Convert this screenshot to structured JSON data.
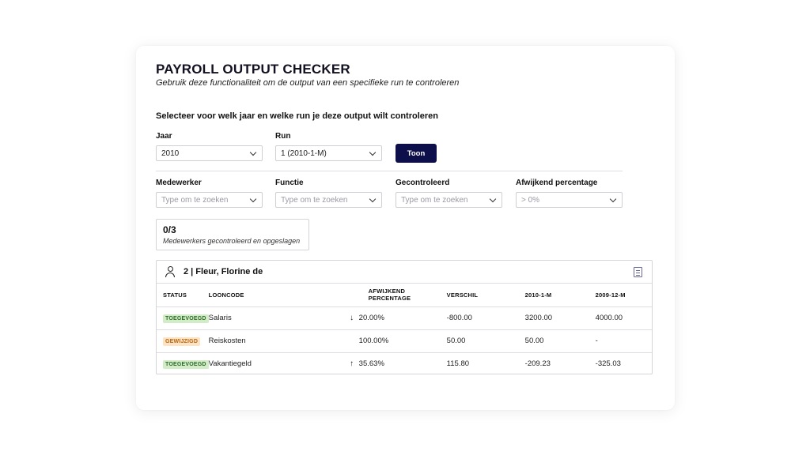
{
  "header": {
    "title": "PAYROLL OUTPUT CHECKER",
    "subtitle": "Gebruik deze functionaliteit om de output van een specifieke run te controleren"
  },
  "selection": {
    "heading": "Selecteer voor welk jaar en welke run je deze output wilt controleren",
    "year_label": "Jaar",
    "year_value": "2010",
    "run_label": "Run",
    "run_value": "1 (2010-1-M)",
    "show_button": "Toon"
  },
  "filters": {
    "employee_label": "Medewerker",
    "employee_placeholder": "Type om te zoeken",
    "function_label": "Functie",
    "function_placeholder": "Type om te zoeken",
    "checked_label": "Gecontroleerd",
    "checked_placeholder": "Type om te zoeken",
    "deviation_label": "Afwijkend percentage",
    "deviation_value": "> 0%"
  },
  "counter": {
    "value": "0/3",
    "description": "Medewerkers gecontroleerd en opgeslagen"
  },
  "employee": {
    "name": "2 | Fleur, Florine de",
    "icons": {
      "user": "user-icon",
      "document": "document-icon"
    }
  },
  "table": {
    "columns": [
      "STATUS",
      "LOONCODE",
      "AFWIJKEND PERCENTAGE",
      "VERSCHIL",
      "2010-1-M",
      "2009-12-M"
    ],
    "rows": [
      {
        "status": "TOEGEVOEGD",
        "status_bg": "#d3ecc8",
        "status_fg": "#2e6b2a",
        "code": "Salaris",
        "arrow": "↓",
        "percentage": "20.00%",
        "difference": "-800.00",
        "current": "3200.00",
        "previous": "4000.00"
      },
      {
        "status": "GEWIJZIGD",
        "status_bg": "#fbe3c4",
        "status_fg": "#b8640f",
        "code": "Reiskosten",
        "arrow": "",
        "percentage": "100.00%",
        "difference": "50.00",
        "current": "50.00",
        "previous": "-"
      },
      {
        "status": "TOEGEVOEGD",
        "status_bg": "#d3ecc8",
        "status_fg": "#2e6b2a",
        "code": "Vakantiegeld",
        "arrow": "↑",
        "percentage": "35.63%",
        "difference": "115.80",
        "current": "-209.23",
        "previous": "-325.03"
      }
    ]
  },
  "colors": {
    "primary_button": "#0d0f4a",
    "added_badge": "#d3ecc8",
    "changed_badge": "#fbe3c4"
  }
}
